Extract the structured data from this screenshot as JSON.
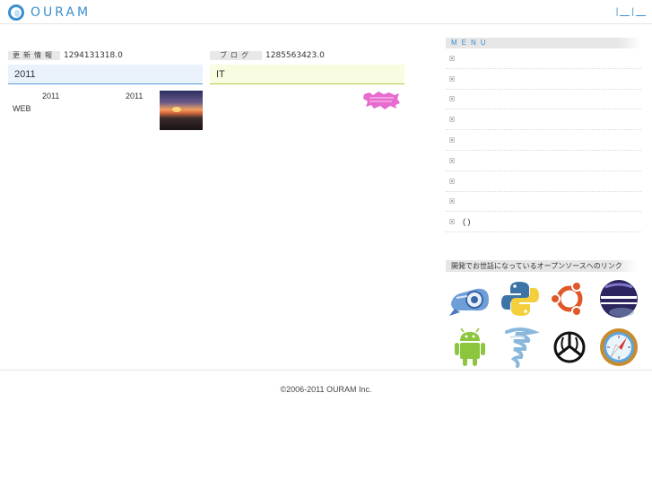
{
  "header": {
    "logo_text": "OURAM",
    "links": [
      "|",
      "|"
    ]
  },
  "news": {
    "tag": "更新情報",
    "value": "1294131318.0",
    "title": "2011",
    "line1": "2011",
    "line2": "2011",
    "line3": "WEB"
  },
  "blog": {
    "tag": "ブログ",
    "value": "1285563423.0",
    "title": "IT"
  },
  "menu": {
    "heading": "MENU",
    "items": [
      "",
      "",
      "",
      "",
      "",
      "",
      "",
      "",
      "(      )"
    ]
  },
  "oss": {
    "heading": "開発でお世話になっているオープンソースへのリンク",
    "icons": [
      "appengine-icon",
      "python-icon",
      "ubuntu-icon",
      "eclipse-icon",
      "android-icon",
      "tornado-icon",
      "github-icon",
      "safari-icon"
    ]
  },
  "footer": {
    "copyright": "©2006-2011 OURAM Inc."
  },
  "colors": {
    "accent": "#3a8fd0",
    "news_title_bg": "#eaf3fc",
    "blog_title_bg": "#f8fce0"
  }
}
